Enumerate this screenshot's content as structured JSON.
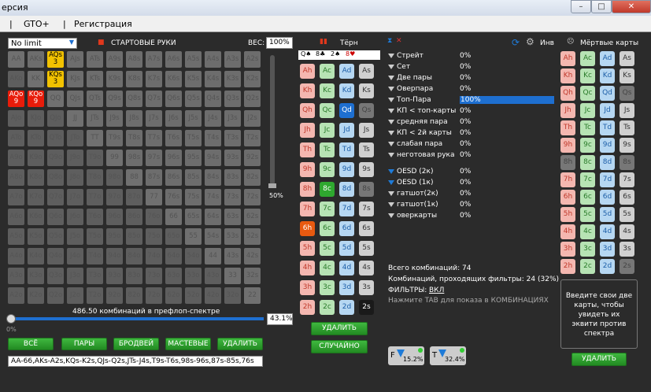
{
  "title": "ерсия",
  "menu": [
    "GTO+",
    "Регистрация"
  ],
  "left": {
    "game_select": "No limit",
    "start_hands": "СТАРТОВЫЕ РУКИ",
    "weight_label": "ВЕС:",
    "weight_value": "100%",
    "grid": [
      [
        "AA",
        "AKs",
        "AQs",
        "AJs",
        "ATs",
        "A9s",
        "A8s",
        "A7s",
        "A6s",
        "A5s",
        "A4s",
        "A3s",
        "A2s"
      ],
      [
        "AKo",
        "KK",
        "KQs",
        "KJs",
        "KTs",
        "K9s",
        "K8s",
        "K7s",
        "K6s",
        "K5s",
        "K4s",
        "K3s",
        "K2s"
      ],
      [
        "AQo",
        "KQo",
        "QQ",
        "QJs",
        "QTs",
        "Q9s",
        "Q8s",
        "Q7s",
        "Q6s",
        "Q5s",
        "Q4s",
        "Q3s",
        "Q2s"
      ],
      [
        "AJo",
        "KJo",
        "QJo",
        "JJ",
        "JTs",
        "J9s",
        "J8s",
        "J7s",
        "J6s",
        "J5s",
        "J4s",
        "J3s",
        "J2s"
      ],
      [
        "ATo",
        "KTo",
        "QTo",
        "JTo",
        "TT",
        "T9s",
        "T8s",
        "T7s",
        "T6s",
        "T5s",
        "T4s",
        "T3s",
        "T2s"
      ],
      [
        "A9o",
        "K9o",
        "Q9o",
        "J9o",
        "T9o",
        "99",
        "98s",
        "97s",
        "96s",
        "95s",
        "94s",
        "93s",
        "92s"
      ],
      [
        "A8o",
        "K8o",
        "Q8o",
        "J8o",
        "T8o",
        "98o",
        "88",
        "87s",
        "86s",
        "85s",
        "84s",
        "83s",
        "82s"
      ],
      [
        "A7o",
        "K7o",
        "Q7o",
        "J7o",
        "T7o",
        "97o",
        "87o",
        "77",
        "76s",
        "75s",
        "74s",
        "73s",
        "72s"
      ],
      [
        "A6o",
        "K6o",
        "Q6o",
        "J6o",
        "T6o",
        "96o",
        "86o",
        "76o",
        "66",
        "65s",
        "64s",
        "63s",
        "62s"
      ],
      [
        "A5o",
        "K5o",
        "Q5o",
        "J5o",
        "T5o",
        "95o",
        "85o",
        "75o",
        "65o",
        "55",
        "54s",
        "53s",
        "52s"
      ],
      [
        "A4o",
        "K4o",
        "Q4o",
        "J4o",
        "T4o",
        "94o",
        "84o",
        "74o",
        "64o",
        "54o",
        "44",
        "43s",
        "42s"
      ],
      [
        "A3o",
        "K3o",
        "Q3o",
        "J3o",
        "T3o",
        "93o",
        "83o",
        "73o",
        "63o",
        "53o",
        "43o",
        "33",
        "32s"
      ],
      [
        "A2o",
        "K2o",
        "Q2o",
        "J2o",
        "T2o",
        "92o",
        "82o",
        "72o",
        "62o",
        "52o",
        "42o",
        "32o",
        "22"
      ]
    ],
    "combos_text": "486.50 комбинаций в префлоп-спектре",
    "slider_pct": "43.1%",
    "slider_zero": "0%",
    "vslider_pct": "50%",
    "buttons": [
      "ВСЁ",
      "ПАРЫ",
      "БРОДВЕЙ",
      "МАСТЕВЫЕ",
      "УДАЛИТЬ"
    ],
    "range_string": "AA-66,AKs-A2s,KQs-K2s,QJs-Q2s,JTs-J4s,T9s-T6s,98s-96s,87s-85s,76s"
  },
  "turn": {
    "title": "Тёрн",
    "board": [
      "Q♠",
      "8♣",
      "2♠",
      "8♥"
    ],
    "delete": "УДАЛИТЬ",
    "random": "СЛУЧАЙНО"
  },
  "filters": {
    "rows": [
      {
        "label": "Стрейт",
        "val": "0%"
      },
      {
        "label": "Сет",
        "val": "0%"
      },
      {
        "label": "Две пары",
        "val": "0%"
      },
      {
        "label": "Оверпара",
        "val": "0%"
      },
      {
        "label": "Топ-Пара",
        "val": "100%"
      },
      {
        "label": "КП < топ-карты",
        "val": "0%"
      },
      {
        "label": "средняя пара",
        "val": "0%"
      },
      {
        "label": "КП < 2й карты",
        "val": "0%"
      },
      {
        "label": "слабая пара",
        "val": "0%"
      },
      {
        "label": "неготовая рука",
        "val": "0%"
      },
      {
        "label": "OESD (2к)",
        "val": "0%"
      },
      {
        "label": "OESD (1к)",
        "val": "0%"
      },
      {
        "label": "гатшот(2к)",
        "val": "0%"
      },
      {
        "label": "гатшот(1к)",
        "val": "0%"
      },
      {
        "label": "оверкарты",
        "val": "0%"
      }
    ],
    "inv": "Инв",
    "total": "Всего комбинаций: 74",
    "passing": "Комбинаций, проходящих фильтры: 24 (32%)",
    "filters_label": "ФИЛЬТРЫ:",
    "filters_state": "ВКЛ",
    "hint": "Нажмите TAB для показа в КОМБИНАЦИЯХ",
    "f_pct": "15.2%",
    "t_pct": "32.4%"
  },
  "dead": {
    "title": "Мёртвые карты",
    "info": "Введите свои две карты, чтобы увидеть их эквити против спектра",
    "delete": "УДАЛИТЬ"
  },
  "colors": {
    "heart": "#f4b7b0",
    "club": "#b7e3b4",
    "diamond": "#b6d7f2",
    "spade": "#d0d0d0"
  }
}
